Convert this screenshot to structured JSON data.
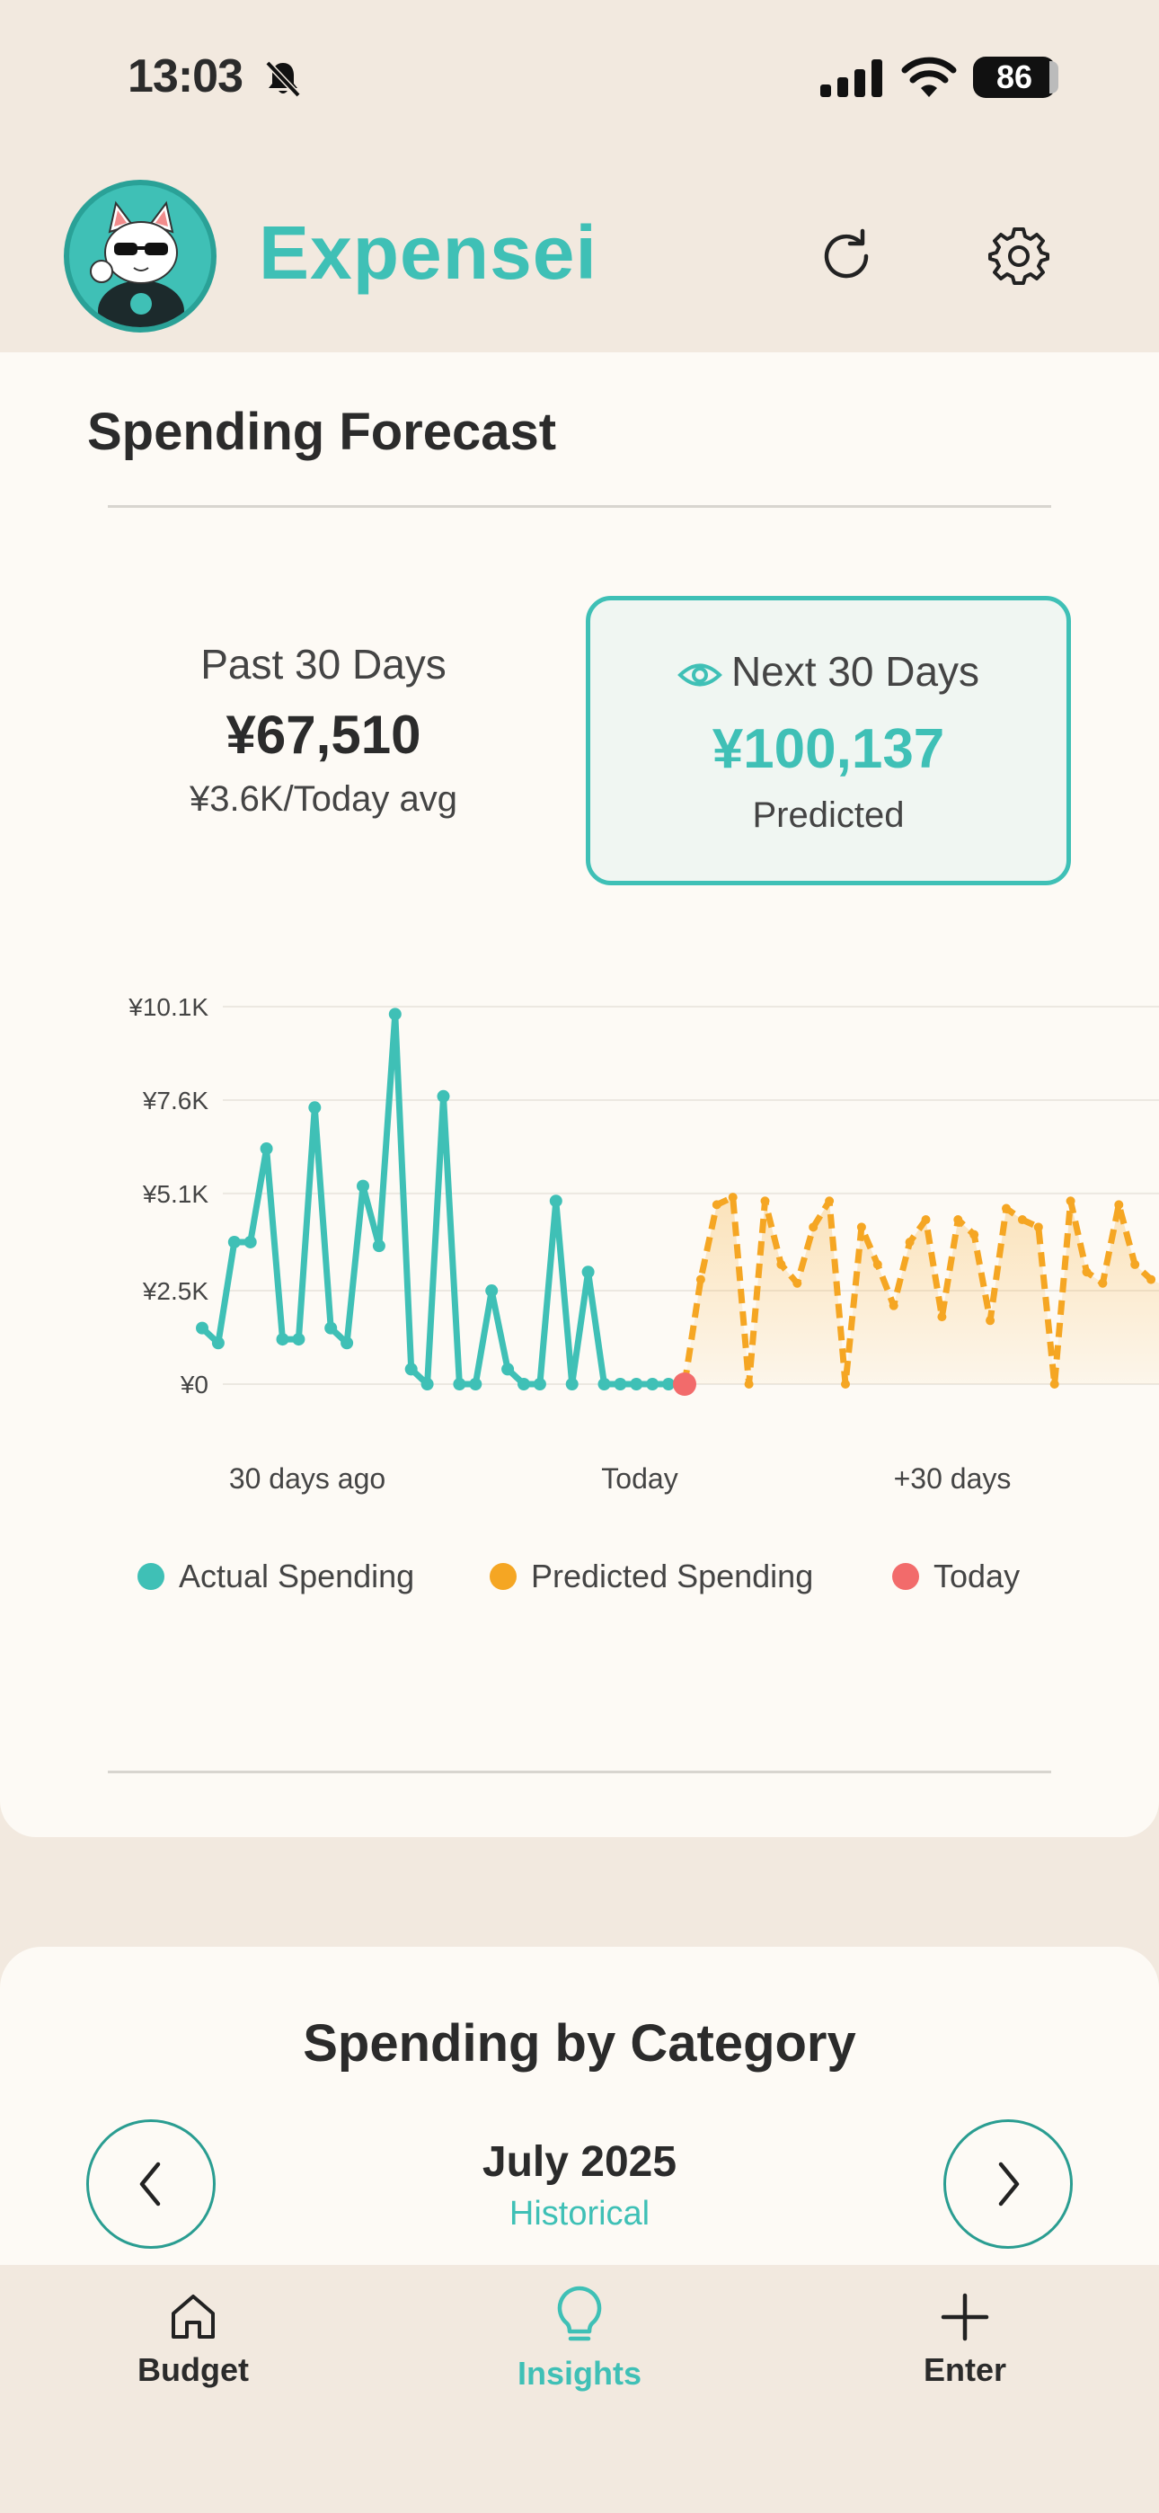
{
  "status_bar": {
    "time": "13:03",
    "battery": "86"
  },
  "header": {
    "app_title": "Expensei"
  },
  "forecast": {
    "title": "Spending Forecast",
    "past": {
      "label": "Past 30 Days",
      "value": "¥67,510",
      "avg": "¥3.6K/Today avg"
    },
    "next": {
      "label": "Next 30 Days",
      "value": "¥100,137",
      "sub": "Predicted"
    }
  },
  "chart_data": {
    "type": "line",
    "y_ticks": [
      "¥10.1K",
      "¥7.6K",
      "¥5.1K",
      "¥2.5K",
      "¥0"
    ],
    "y_tick_values": [
      10100,
      7600,
      5100,
      2500,
      0
    ],
    "x_ticks": [
      "30 days ago",
      "Today",
      "+30 days"
    ],
    "ylim": [
      0,
      10100
    ],
    "series": [
      {
        "name": "Actual Spending",
        "color": "#3fc0b6",
        "style": "solid",
        "x": [
          -30,
          -29,
          -28,
          -27,
          -26,
          -25,
          -24,
          -23,
          -22,
          -21,
          -20,
          -19,
          -18,
          -17,
          -16,
          -15,
          -14,
          -13,
          -12,
          -11,
          -10,
          -9,
          -8,
          -7,
          -6,
          -5,
          -4,
          -3,
          -2,
          -1,
          0
        ],
        "values": [
          1500,
          1100,
          3800,
          3800,
          6300,
          1200,
          1200,
          7400,
          1500,
          1100,
          5300,
          3700,
          9900,
          400,
          0,
          7700,
          0,
          0,
          2500,
          400,
          0,
          0,
          4900,
          0,
          3000,
          0,
          0,
          0,
          0,
          0,
          0
        ]
      },
      {
        "name": "Predicted Spending",
        "color": "#f5a623",
        "style": "dashed",
        "x": [
          0,
          1,
          2,
          3,
          4,
          5,
          6,
          7,
          8,
          9,
          10,
          11,
          12,
          13,
          14,
          15,
          16,
          17,
          18,
          19,
          20,
          21,
          22,
          23,
          24,
          25,
          26,
          27,
          28,
          29,
          30
        ],
        "values": [
          0,
          2800,
          4800,
          5000,
          0,
          4900,
          3200,
          2700,
          4200,
          4900,
          0,
          4200,
          3200,
          2100,
          3800,
          4400,
          1800,
          4400,
          4000,
          1700,
          4700,
          4400,
          4200,
          0,
          4900,
          3000,
          2700,
          4800,
          3200,
          2800,
          2600
        ]
      }
    ],
    "today_marker": {
      "label": "Today",
      "color": "#f26b6b",
      "x": 0,
      "y": 0
    },
    "legend": [
      "Actual Spending",
      "Predicted Spending",
      "Today"
    ],
    "grid": true
  },
  "category": {
    "title": "Spending by Category",
    "month": "July 2025",
    "status": "Historical"
  },
  "tabs": [
    {
      "label": "Budget"
    },
    {
      "label": "Insights"
    },
    {
      "label": "Enter"
    }
  ]
}
